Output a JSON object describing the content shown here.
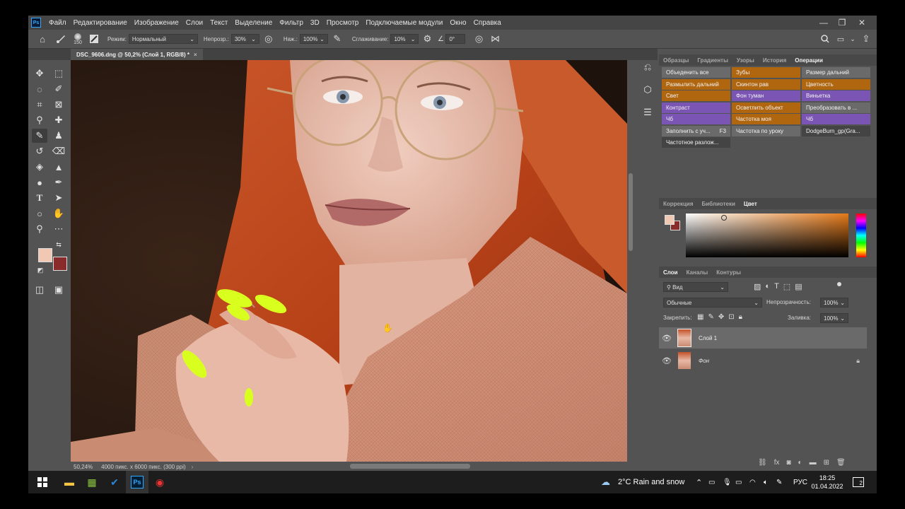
{
  "menu": [
    "Файл",
    "Редактирование",
    "Изображение",
    "Слои",
    "Текст",
    "Выделение",
    "Фильтр",
    "3D",
    "Просмотр",
    "Подключаемые модули",
    "Окно",
    "Справка"
  ],
  "ps_badge": "Ps",
  "window_controls": {
    "minimize": "—",
    "restore": "❐",
    "close": "✕"
  },
  "options": {
    "brush_size": "150",
    "mode_label": "Режим:",
    "mode_value": "Нормальный",
    "opacity_label": "Непрозр.:",
    "opacity_value": "30%",
    "pressure_label": "Наж.:",
    "pressure_value": "100%",
    "smoothing_label": "Сглаживание:",
    "smoothing_value": "10%",
    "angle_value": "0°"
  },
  "document_tab": "DSC_9606.dng @ 50,2% (Слой 1, RGB/8) *",
  "status": {
    "zoom": "50,24%",
    "info": "4000 пикс. x 6000 пикс. (300 ppi)"
  },
  "top_panel_tabs": [
    "Образцы",
    "Градиенты",
    "Узоры",
    "История",
    "Операции"
  ],
  "actions": [
    {
      "label": "Объеденить все",
      "color": "gray"
    },
    {
      "label": "Зубы",
      "color": "orange"
    },
    {
      "label": "Размер дальний",
      "color": "gray"
    },
    {
      "label": "Размылить дальний",
      "color": "orange"
    },
    {
      "label": "Скинтон рав",
      "color": "orange"
    },
    {
      "label": "Цветность",
      "color": "orange"
    },
    {
      "label": "Свет",
      "color": "orange"
    },
    {
      "label": "Фон туман",
      "color": "purple"
    },
    {
      "label": "Виньетка",
      "color": "purple"
    },
    {
      "label": "Контраст",
      "color": "purple"
    },
    {
      "label": "Осветлить объект",
      "color": "orange"
    },
    {
      "label": "Преобразовать в ...",
      "color": "gray"
    },
    {
      "label": "Чб",
      "color": "purple"
    },
    {
      "label": "Частотка моя",
      "color": "orange"
    },
    {
      "label": "Чб",
      "color": "purple"
    },
    {
      "label": "Заполнить с уч...",
      "shortcut": "F3",
      "color": "gray"
    },
    {
      "label": "Частотка по уроку",
      "color": "gray"
    },
    {
      "label": "DodgeBurn_gp(Gra...",
      "color": "dark"
    },
    {
      "label": "Частотное разлож...",
      "color": "dark"
    }
  ],
  "color_panel_tabs": [
    "Коррекция",
    "Библиотеки",
    "Цвет"
  ],
  "layers_panel_tabs": [
    "Слои",
    "Каналы",
    "Контуры"
  ],
  "layers": {
    "filter_value": "Вид",
    "blend_mode": "Обычные",
    "opacity_label": "Непрозрачность:",
    "opacity_value": "100%",
    "lock_label": "Закрепить:",
    "fill_label": "Заливка:",
    "fill_value": "100%",
    "items": [
      {
        "name": "Слой 1",
        "selected": true
      },
      {
        "name": "Фон",
        "selected": false,
        "locked": true
      }
    ]
  },
  "colors": {
    "foreground": "#f0c8b4",
    "background": "#8a2b2b",
    "action_gray": "#6a6a6a",
    "action_orange": "#b0650f",
    "action_purple": "#7a55b4",
    "action_dark": "#444444"
  },
  "taskbar": {
    "weather": "2°C  Rain and snow",
    "lang": "РУС",
    "time": "18:25",
    "date": "01.04.2022",
    "notifications": "2"
  }
}
